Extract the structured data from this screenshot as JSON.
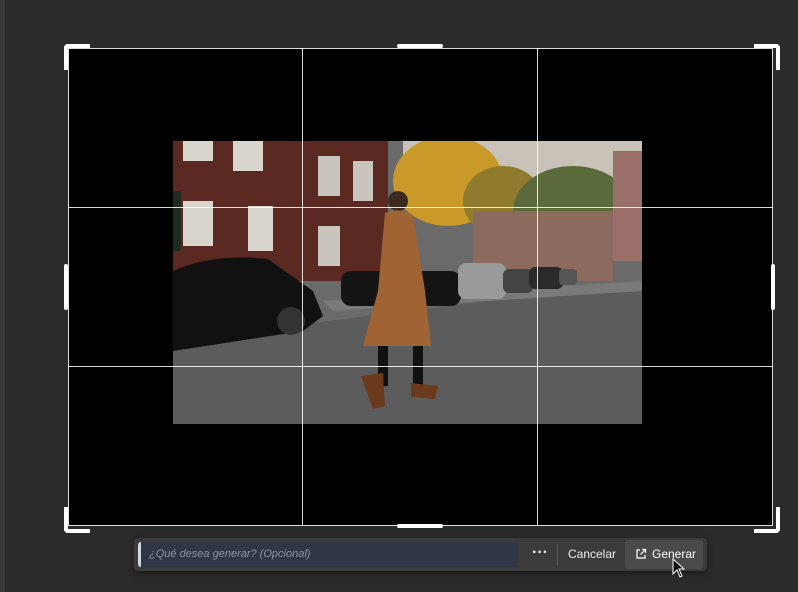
{
  "prompt_bar": {
    "input_placeholder": "¿Qué desea generar?  (Opcional)",
    "more_label": "···",
    "cancel_label": "Cancelar",
    "generate_label": "Generar",
    "generate_icon": "open-external-icon"
  },
  "image": {
    "icon": "photo-street-woman-coat"
  },
  "colors": {
    "canvas_bg": "#2b2b2b",
    "crop_fill": "#000000",
    "input_bg": "#2f3747",
    "bar_bg": "#3b3b3b"
  }
}
